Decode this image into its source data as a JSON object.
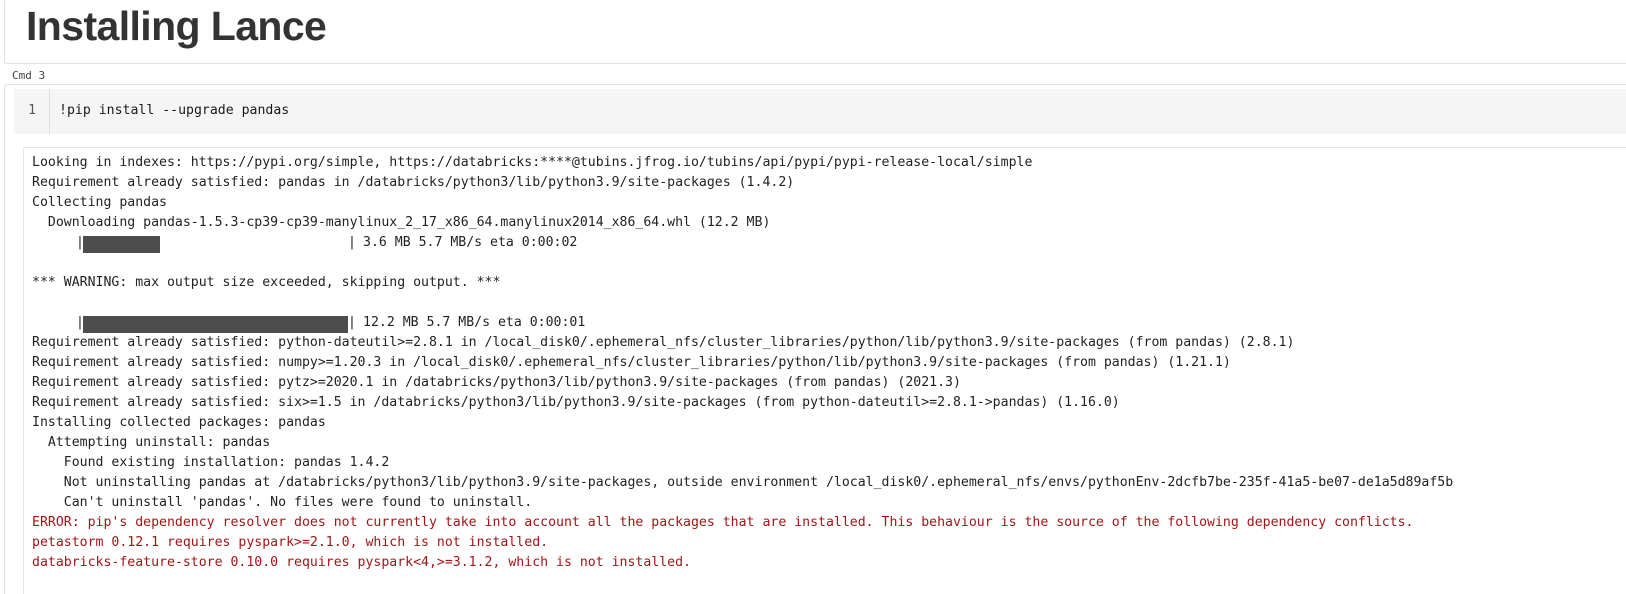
{
  "markdown_cell": {
    "title": "Installing Lance"
  },
  "command_cell": {
    "label": "Cmd 3",
    "line_number": "1",
    "code": "!pip install --upgrade pandas"
  },
  "output": {
    "line_1": "Looking in indexes: https://pypi.org/simple, https://databricks:****@tubins.jfrog.io/tubins/api/pypi/pypi-release-local/simple",
    "line_2": "Requirement already satisfied: pandas in /databricks/python3/lib/python3.9/site-packages (1.4.2)",
    "line_3": "Collecting pandas",
    "line_4": "  Downloading pandas-1.5.3-cp39-cp39-manylinux_2_17_x86_64.manylinux2014_x86_64.whl (12.2 MB)",
    "progress_1": {
      "fraction": 0.29,
      "bar_start": "|",
      "bar_end": "|",
      "status": "3.6 MB 5.7 MB/s eta 0:00:02"
    },
    "warning": "*** WARNING: max output size exceeded, skipping output. ***",
    "progress_2": {
      "fraction": 1.0,
      "bar_start": "|",
      "bar_end": "|",
      "status": "12.2 MB 5.7 MB/s eta 0:00:01"
    },
    "line_10": "Requirement already satisfied: python-dateutil>=2.8.1 in /local_disk0/.ephemeral_nfs/cluster_libraries/python/lib/python3.9/site-packages (from pandas) (2.8.1)",
    "line_11": "Requirement already satisfied: numpy>=1.20.3 in /local_disk0/.ephemeral_nfs/cluster_libraries/python/lib/python3.9/site-packages (from pandas) (1.21.1)",
    "line_12": "Requirement already satisfied: pytz>=2020.1 in /databricks/python3/lib/python3.9/site-packages (from pandas) (2021.3)",
    "line_13": "Requirement already satisfied: six>=1.5 in /databricks/python3/lib/python3.9/site-packages (from python-dateutil>=2.8.1->pandas) (1.16.0)",
    "line_14": "Installing collected packages: pandas",
    "line_15": "  Attempting uninstall: pandas",
    "line_16": "    Found existing installation: pandas 1.4.2",
    "line_17": "    Not uninstalling pandas at /databricks/python3/lib/python3.9/site-packages, outside environment /local_disk0/.ephemeral_nfs/envs/pythonEnv-2dcfb7be-235f-41a5-be07-de1a5d89af5b",
    "line_18": "    Can't uninstall 'pandas'. No files were found to uninstall.",
    "error_1": "ERROR: pip's dependency resolver does not currently take into account all the packages that are installed. This behaviour is the source of the following dependency conflicts.",
    "error_2": "petastorm 0.12.1 requires pyspark>=2.1.0, which is not installed.",
    "error_3": "databricks-feature-store 0.10.0 requires pyspark<4,>=3.1.2, which is not installed."
  },
  "colors": {
    "error_text": "#a31515",
    "progress_fill": "#4d4d4d",
    "editor_background": "#f5f5f5"
  }
}
